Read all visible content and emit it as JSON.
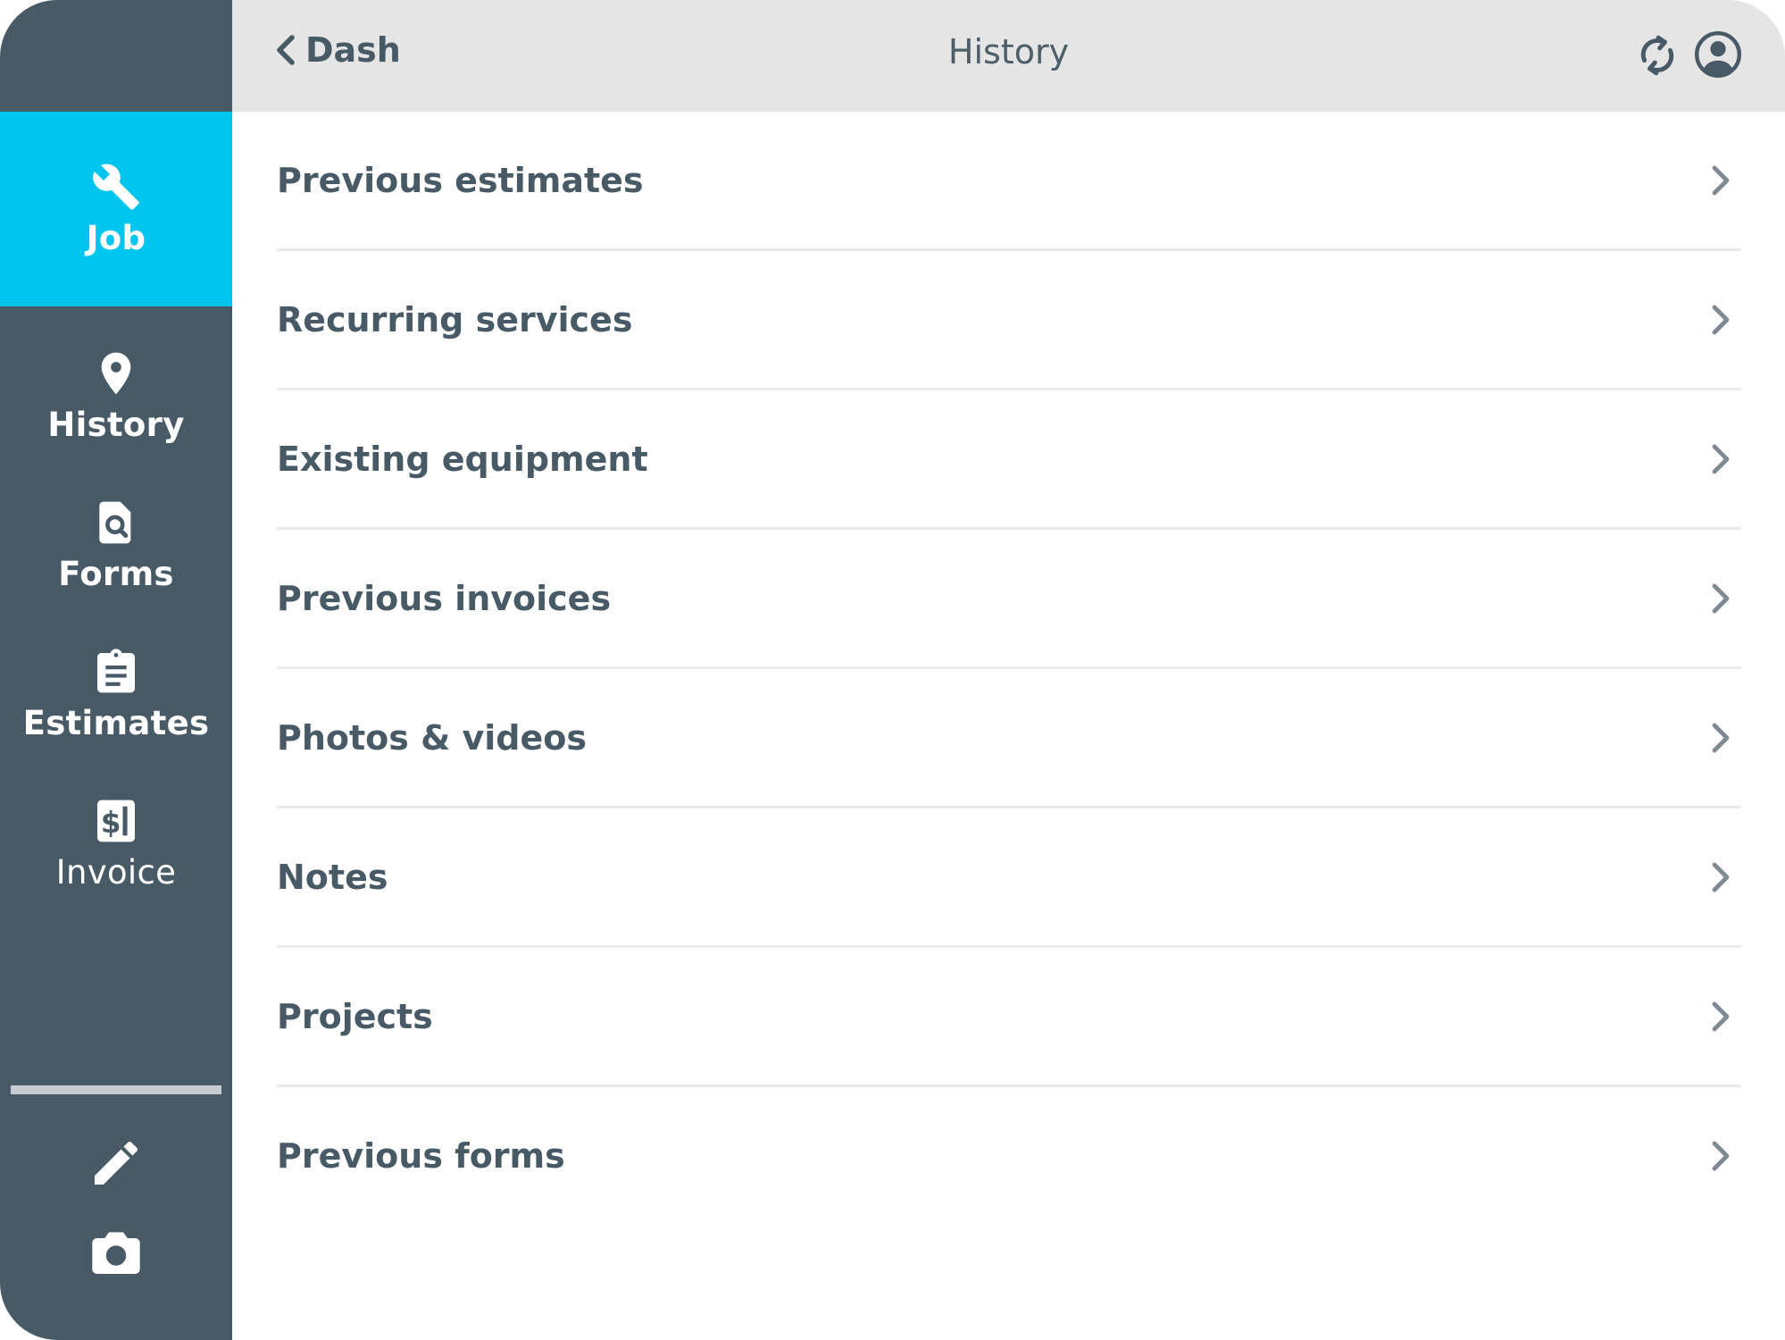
{
  "topbar": {
    "back_label": "Dash",
    "title": "History"
  },
  "sidebar": {
    "items": [
      {
        "label": "Job",
        "icon": "wrench-icon",
        "active": true
      },
      {
        "label": "History",
        "icon": "map-pin-icon",
        "active": false
      },
      {
        "label": "Forms",
        "icon": "form-search-icon",
        "active": false
      },
      {
        "label": "Estimates",
        "icon": "clipboard-icon",
        "active": false
      },
      {
        "label": "Invoice",
        "icon": "invoice-dollar-icon",
        "active": false
      }
    ],
    "tools": [
      {
        "icon": "pencil-icon"
      },
      {
        "icon": "camera-icon"
      }
    ]
  },
  "list": {
    "items": [
      {
        "label": "Previous estimates"
      },
      {
        "label": "Recurring services"
      },
      {
        "label": "Existing equipment"
      },
      {
        "label": "Previous invoices"
      },
      {
        "label": "Photos & videos"
      },
      {
        "label": "Notes"
      },
      {
        "label": "Projects"
      },
      {
        "label": "Previous forms"
      }
    ]
  },
  "colors": {
    "sidebar_bg": "#485a66",
    "accent": "#00c5ee",
    "topbar_bg": "#e5e5e5",
    "text": "#485a66"
  }
}
